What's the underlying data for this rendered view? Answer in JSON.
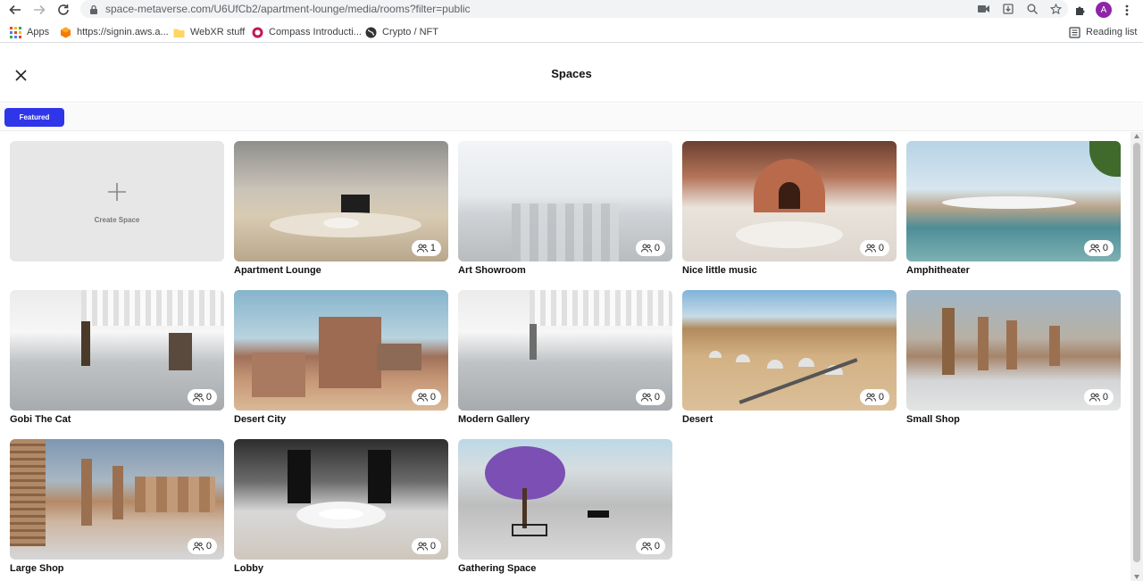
{
  "browser": {
    "url": "space-metaverse.com/U6UfCb2/apartment-lounge/media/rooms?filter=public",
    "profile_initial": "A",
    "bookmarks": [
      {
        "label": "Apps"
      },
      {
        "label": "https://signin.aws.a..."
      },
      {
        "label": "WebXR stuff"
      },
      {
        "label": "Compass Introducti..."
      },
      {
        "label": "Crypto / NFT"
      }
    ],
    "reading_list": "Reading list"
  },
  "header": {
    "title": "Spaces"
  },
  "tabs": {
    "featured": "Featured"
  },
  "create": {
    "label": "Create Space"
  },
  "spaces": [
    {
      "name": "Apartment Lounge",
      "count": "1"
    },
    {
      "name": "Art Showroom",
      "count": "0"
    },
    {
      "name": "Nice little music",
      "count": "0"
    },
    {
      "name": "Amphitheater",
      "count": "0"
    },
    {
      "name": "Gobi The Cat",
      "count": "0"
    },
    {
      "name": "Desert City",
      "count": "0"
    },
    {
      "name": "Modern Gallery",
      "count": "0"
    },
    {
      "name": "Desert",
      "count": "0"
    },
    {
      "name": "Small Shop",
      "count": "0"
    },
    {
      "name": "Large Shop",
      "count": "0"
    },
    {
      "name": "Lobby",
      "count": "0"
    },
    {
      "name": "Gathering Space",
      "count": "0"
    }
  ],
  "colors": {
    "accent": "#2f35e8"
  }
}
